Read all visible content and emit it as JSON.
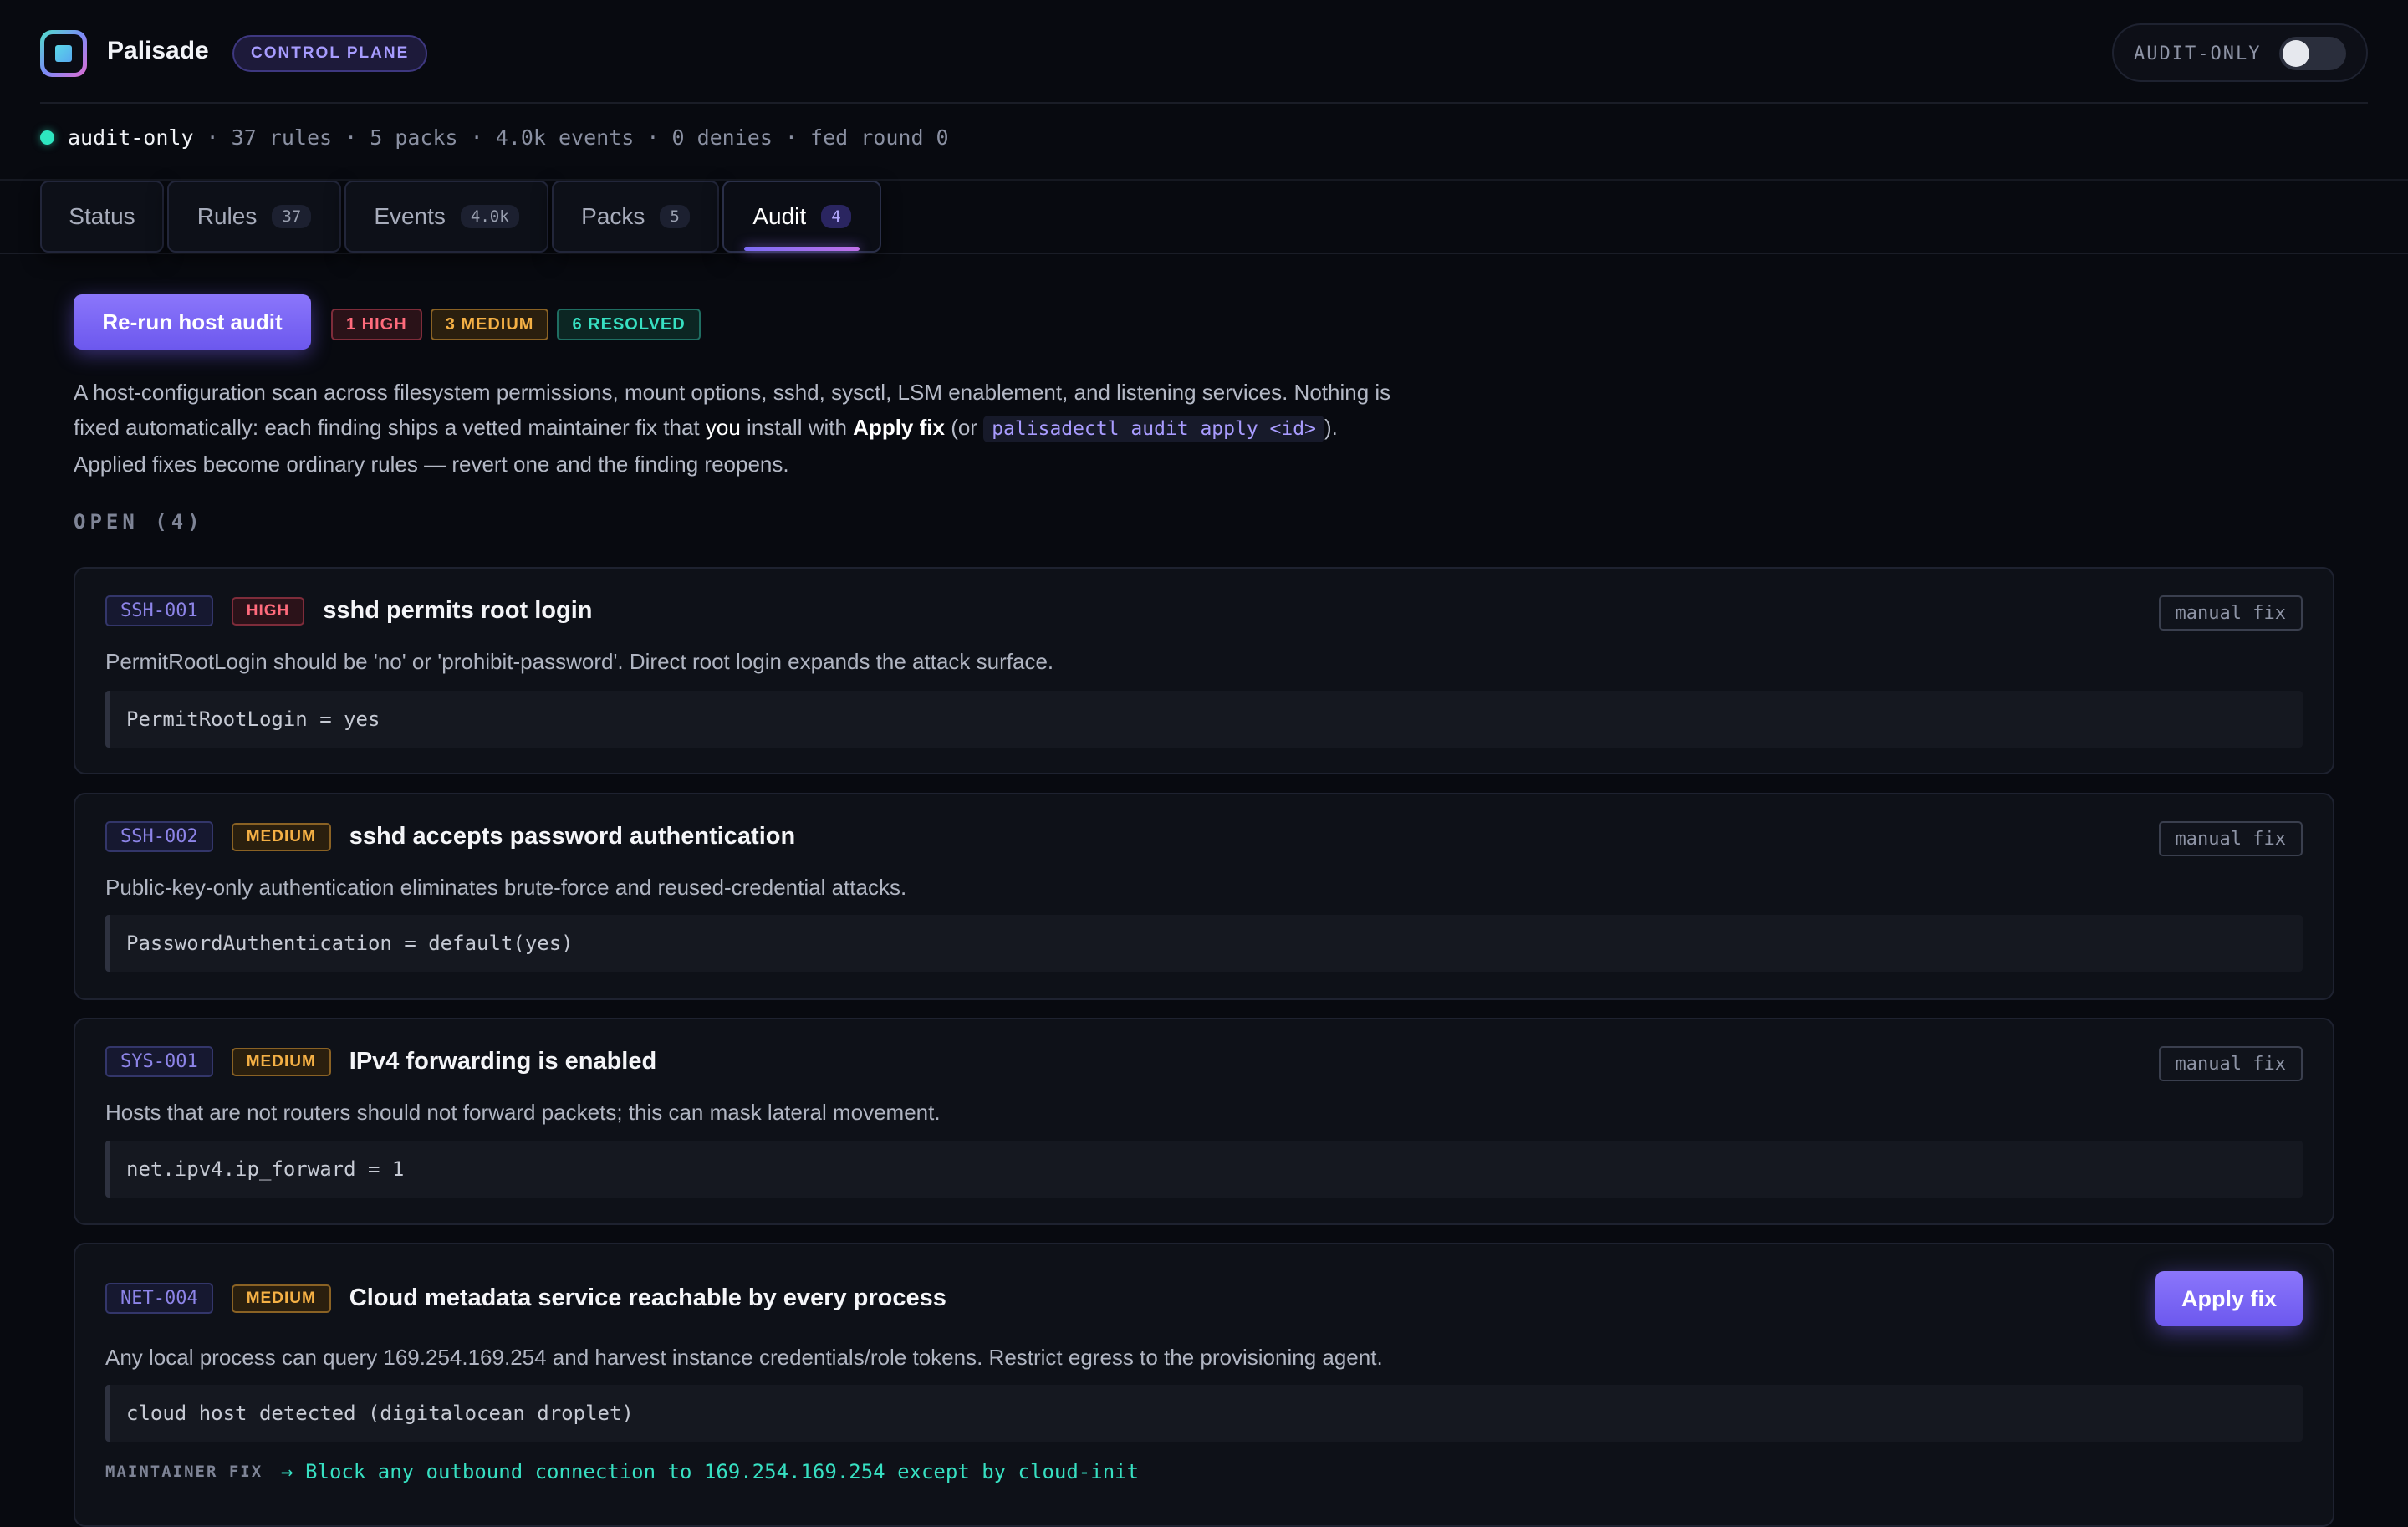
{
  "app": {
    "name": "Palisade",
    "badge": "CONTROL PLANE",
    "mode_toggle_label": "AUDIT-ONLY",
    "mode_toggle_on": false
  },
  "status": {
    "mode": "audit-only",
    "rest": " · 37 rules · 5 packs · 4.0k events · 0 denies · fed round 0"
  },
  "tabs": [
    {
      "label": "Status",
      "count": ""
    },
    {
      "label": "Rules",
      "count": "37"
    },
    {
      "label": "Events",
      "count": "4.0k"
    },
    {
      "label": "Packs",
      "count": "5"
    },
    {
      "label": "Audit",
      "count": "4",
      "active": true
    }
  ],
  "audit": {
    "rerun_label": "Re-run host audit",
    "summary": {
      "high": "1 HIGH",
      "medium": "3 MEDIUM",
      "resolved": "6 RESOLVED"
    },
    "intro": {
      "p1": "A host-configuration scan across filesystem permissions, mount options, sshd, sysctl, LSM enablement, and listening services. Nothing is fixed automatically: each finding ships a vetted maintainer fix that ",
      "you": "you",
      "p2": " install with ",
      "apply": "Apply fix",
      "p3": " (or ",
      "cmd": "palisadectl audit apply <id>",
      "p4": "). Applied fixes become ordinary rules — revert one and the finding reopens."
    },
    "open_title": "OPEN (4)",
    "findings": [
      {
        "id": "SSH-001",
        "severity": "HIGH",
        "title": "sshd permits root login",
        "description": "PermitRootLogin should be 'no' or 'prohibit-password'. Direct root login expands the attack surface.",
        "evidence": "PermitRootLogin = yes",
        "action": "manual fix"
      },
      {
        "id": "SSH-002",
        "severity": "MEDIUM",
        "title": "sshd accepts password authentication",
        "description": "Public-key-only authentication eliminates brute-force and reused-credential attacks.",
        "evidence": "PasswordAuthentication = default(yes)",
        "action": "manual fix"
      },
      {
        "id": "SYS-001",
        "severity": "MEDIUM",
        "title": "IPv4 forwarding is enabled",
        "description": "Hosts that are not routers should not forward packets; this can mask lateral movement.",
        "evidence": "net.ipv4.ip_forward = 1",
        "action": "manual fix"
      },
      {
        "id": "NET-004",
        "severity": "MEDIUM",
        "title": "Cloud metadata service reachable by every process",
        "description": "Any local process can query 169.254.169.254 and harvest instance credentials/role tokens. Restrict egress to the provisioning agent.",
        "evidence": "cloud host detected (digitalocean droplet)",
        "action": "Apply fix",
        "maintainer_label": "MAINTAINER FIX",
        "maintainer_fix": "→ Block any outbound connection to 169.254.169.254 except by cloud-init"
      }
    ]
  },
  "colors": {
    "accent": "#7c6cf6",
    "high": "#ff6b7c",
    "medium": "#f4b045",
    "resolved": "#37e0c2"
  }
}
